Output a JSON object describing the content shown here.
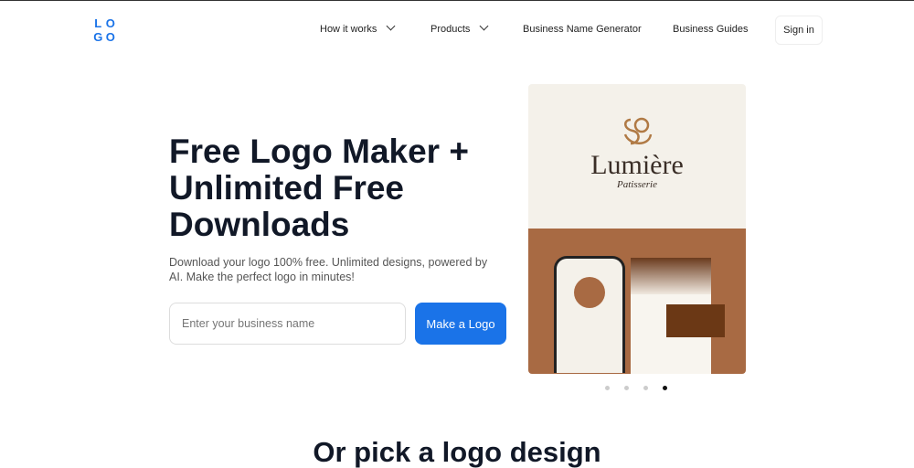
{
  "header": {
    "logo_letters": [
      "L",
      "O",
      "G",
      "O"
    ],
    "nav": [
      {
        "label": "How it works",
        "dropdown": true
      },
      {
        "label": "Products",
        "dropdown": true
      },
      {
        "label": "Business Name Generator"
      },
      {
        "label": "Business Guides"
      }
    ],
    "signin": "Sign in"
  },
  "hero": {
    "title": "Free Logo Maker + Unlimited Free Downloads",
    "subtitle": "Download your logo 100% free. Unlimited designs, powered by AI. Make the perfect logo in minutes!",
    "input_placeholder": "Enter your business name",
    "cta": "Make a Logo",
    "accent": "#1a73e8"
  },
  "carousel": {
    "brand": "Lumière",
    "tagline": "Patisserie",
    "slides": 4,
    "active_slide": 4
  },
  "section": {
    "title": "Or pick a logo design"
  }
}
